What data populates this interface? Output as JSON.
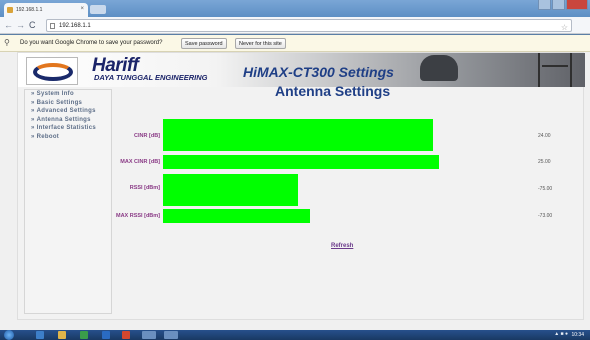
{
  "browser": {
    "tab_title": "192.168.1.1",
    "address": "192.168.1.1",
    "password_prompt": "Do you want Google Chrome to save your password?",
    "save_password_label": "Save password",
    "never_label": "Never for this site"
  },
  "banner": {
    "brand": "Hariff",
    "brand_sub": "DAYA TUNGGAL ENGINEERING",
    "title": "HiMAX-CT300 Settings"
  },
  "sidebar": {
    "items": [
      {
        "label": "System Info"
      },
      {
        "label": "Basic Settings"
      },
      {
        "label": "Advanced Settings"
      },
      {
        "label": "Antenna Settings"
      },
      {
        "label": "Interface Statistics"
      },
      {
        "label": "Reboot"
      }
    ]
  },
  "main": {
    "title": "Antenna Settings",
    "meters": [
      {
        "label": "CINR [dB]",
        "value_text": "24.00",
        "level": 0.9
      },
      {
        "label": "MAX CINR [dB]",
        "value_text": "25.00",
        "level": 0.92
      },
      {
        "label": "RSSI [dBm]",
        "value_text": "-75.00",
        "level": 0.45
      },
      {
        "label": "MAX RSSI [dBm]",
        "value_text": "-73.00",
        "level": 0.49
      }
    ],
    "refresh_label": "Refresh"
  },
  "taskbar": {
    "clock": "10:34"
  },
  "colors": {
    "bar": "#00ff00",
    "title": "#1f3f86",
    "label": "#8a3b86"
  }
}
